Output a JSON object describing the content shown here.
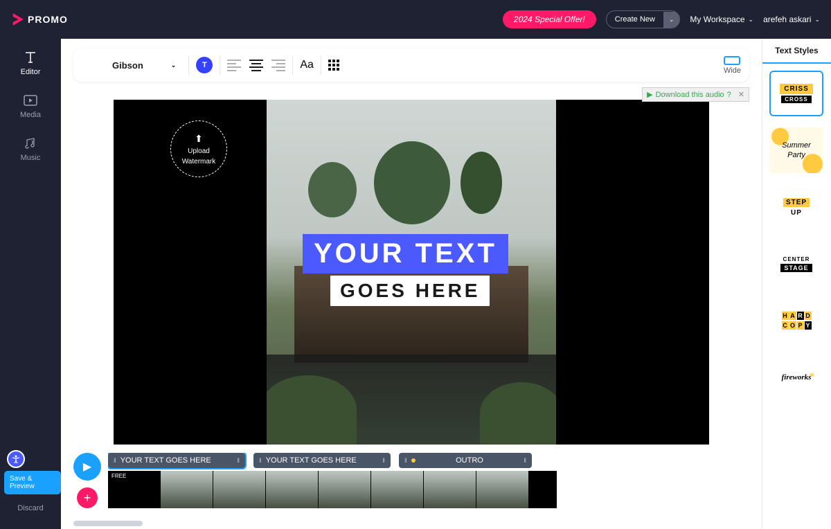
{
  "brand": "PROMO",
  "header": {
    "special_offer": "2024 Special Offer!",
    "create_new": "Create New",
    "workspace": "My Workspace",
    "user": "arefeh askari"
  },
  "left_rail": {
    "editor": "Editor",
    "media": "Media",
    "music": "Music",
    "save_preview": "Save & Preview",
    "discard": "Discard"
  },
  "toolbar": {
    "font": "Gibson",
    "ratio_label": "Wide"
  },
  "canvas": {
    "watermark_line1": "Upload",
    "watermark_line2": "Watermark",
    "text_top": "YOUR TEXT",
    "text_bottom": "GOES HERE",
    "download_audio": "Download this audio"
  },
  "timeline": {
    "segments": [
      {
        "label": "YOUR TEXT GOES HERE",
        "type": "text",
        "active": true
      },
      {
        "label": "YOUR TEXT GOES HERE",
        "type": "text",
        "active": false
      },
      {
        "label": "OUTRO",
        "type": "outro",
        "active": false
      }
    ],
    "free_tag": "FREE"
  },
  "right_panel": {
    "title": "Text Styles",
    "styles": [
      {
        "id": "criss-cross",
        "line1": "CRISS",
        "line2": "CROSS",
        "selected": true
      },
      {
        "id": "summer-party",
        "line1": "Summer",
        "line2": "Party"
      },
      {
        "id": "step-up",
        "line1": "STEP",
        "line2": "UP"
      },
      {
        "id": "center-stage",
        "line1": "CENTER",
        "line2": "STAGE"
      },
      {
        "id": "hard-copy",
        "line1": "HARD",
        "line2": "COPY"
      },
      {
        "id": "fireworks",
        "line1": "fireworks"
      }
    ]
  }
}
